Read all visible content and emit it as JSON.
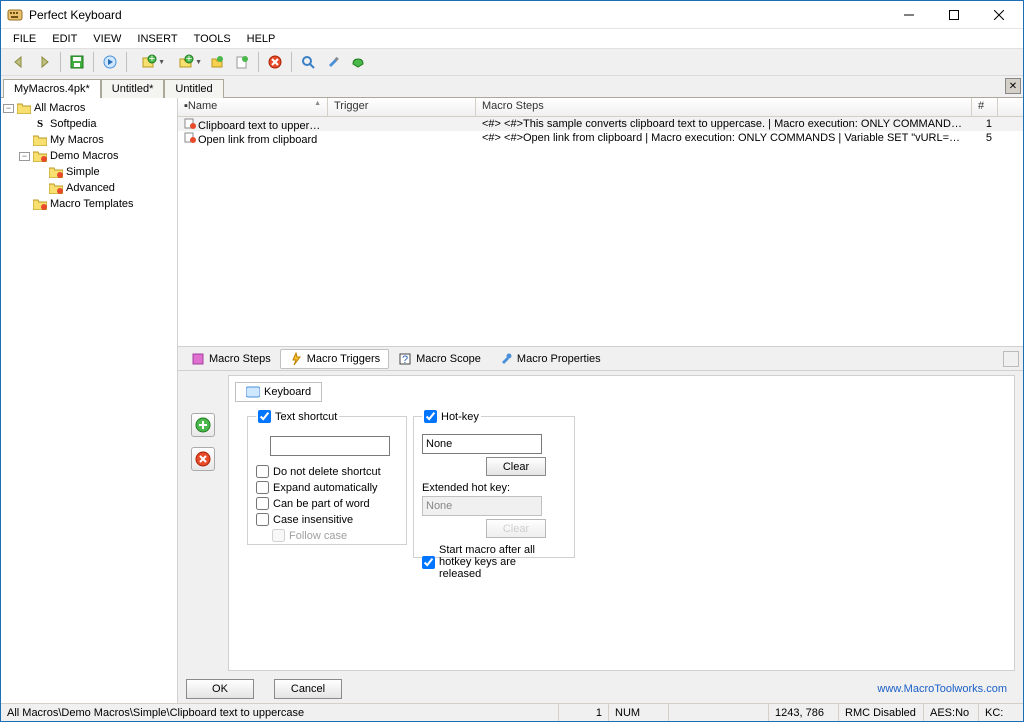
{
  "window": {
    "title": "Perfect Keyboard"
  },
  "menus": [
    "FILE",
    "EDIT",
    "VIEW",
    "INSERT",
    "TOOLS",
    "HELP"
  ],
  "docTabs": [
    "MyMacros.4pk*",
    "Untitled*",
    "Untitled"
  ],
  "activeDocTab": 0,
  "tree": {
    "root": "All Macros",
    "nodes": [
      {
        "label": "Softpedia",
        "indent": 1,
        "icon": "s"
      },
      {
        "label": "My Macros",
        "indent": 1,
        "icon": "folder"
      },
      {
        "label": "Demo Macros",
        "indent": 1,
        "icon": "folder-red",
        "exp": "-"
      },
      {
        "label": "Simple",
        "indent": 2,
        "icon": "folder-red",
        "selected": true
      },
      {
        "label": "Advanced",
        "indent": 2,
        "icon": "folder-red"
      },
      {
        "label": "Macro Templates",
        "indent": 1,
        "icon": "folder-red"
      }
    ]
  },
  "list": {
    "headers": {
      "name": "Name",
      "trigger": "Trigger",
      "steps": "Macro Steps",
      "num": "#"
    },
    "rows": [
      {
        "name": "Clipboard text to uppercase",
        "trigger": "",
        "steps": "<#> <#>This sample converts clipboard text to uppercase. | Macro execution: ONLY COMMANDS | Key Enter | Variable OPERATI...",
        "num": "1",
        "sel": true
      },
      {
        "name": "Open link from clipboard",
        "trigger": "",
        "steps": "<#> <#>Open link from clipboard | Macro execution: ONLY COMMANDS | Variable SET \"vURL=%_vClpText%\", Message text=\"<n...",
        "num": "5"
      }
    ]
  },
  "bottomTabs": [
    "Macro Steps",
    "Macro Triggers",
    "Macro Scope",
    "Macro Properties"
  ],
  "activeBottomTab": 1,
  "triggerPane": {
    "keyboardTab": "Keyboard",
    "textShortcut": {
      "title": "Text shortcut",
      "value": "",
      "opts": [
        "Do not delete shortcut",
        "Expand automatically",
        "Can be part of word",
        "Case insensitive"
      ],
      "followCase": "Follow case"
    },
    "hotkey": {
      "title": "Hot-key",
      "value": "None",
      "clear": "Clear",
      "extLabel": "Extended hot key:",
      "extValue": "None",
      "extClear": "Clear",
      "startAfter": "Start macro after all hotkey keys are released"
    }
  },
  "buttons": {
    "ok": "OK",
    "cancel": "Cancel"
  },
  "footerLink": "www.MacroToolworks.com",
  "status": {
    "path": "All Macros\\Demo Macros\\Simple\\Clipboard text to uppercase",
    "count": "1",
    "num": "NUM",
    "coords": "1243, 786",
    "rmc": "RMC Disabled",
    "aes": "AES:No",
    "kc": "KC:"
  }
}
